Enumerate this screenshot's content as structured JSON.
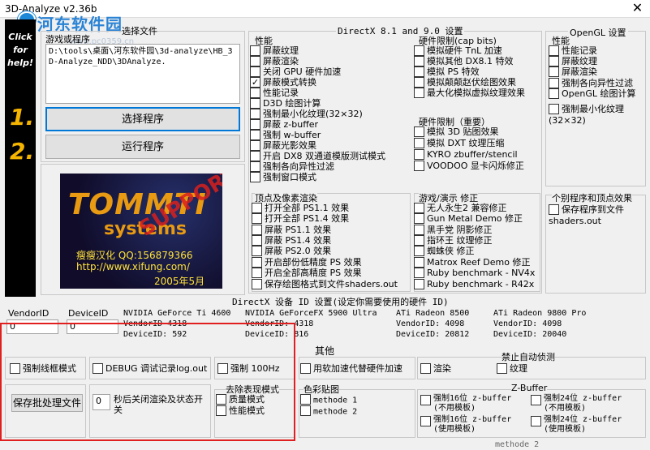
{
  "window": {
    "title": "3D-Analyze v2.36b",
    "close_glyph": "✕"
  },
  "watermark": {
    "name": "河东软件园",
    "url": "www.pc0359.cn"
  },
  "strip": {
    "click_text": "Click\nfor\nhelp!",
    "step1": "1.",
    "step2": "2."
  },
  "program": {
    "section_label": "游戏或程序",
    "select_file_label": "选择文件",
    "path_text": "D:\\tools\\桌面\\河东软件园\\3d-analyze\\HB_3D-Analyze_NDD\\3DAnalyze.",
    "select_button": "选择程序",
    "run_button": "运行程序"
  },
  "logo": {
    "brand_line1": "TOMMTI",
    "brand_line2": "systems",
    "overlay": "SUPPORT",
    "credit": "瘦瘦汉化 QQ:156879366",
    "url": "http://www.xifung.com/",
    "date": "2005年5月"
  },
  "directx": {
    "header": "DirectX 8.1 and 9.0 设置",
    "performance": {
      "title": "性能",
      "items": [
        "屏蔽纹理",
        "屏蔽渲染",
        "关闭 GPU 硬件加速",
        "屏蔽模式转换",
        "性能记录",
        "D3D 绘图计算",
        "强制最小化纹理(32×32)",
        "屏蔽 z-buffer",
        "强制 w-buffer",
        "屏蔽光影效果",
        "开启 DX8 双通道模版测试模式",
        "强制各向异性过滤",
        "强制窗口模式"
      ],
      "checked": [
        false,
        false,
        false,
        true,
        false,
        false,
        false,
        false,
        false,
        false,
        false,
        false,
        false
      ]
    },
    "hwlimit_cap": {
      "title": "硬件限制(cap bits)",
      "items": [
        "模拟硬件 TnL 加速",
        "模拟其他 DX8.1 特效",
        "模拟 PS 特效",
        "模拟颠颠赵伏绘图效果",
        "最大化模拟虚拟纹理效果"
      ]
    },
    "hwlimit_important": {
      "title": "硬件限制（重要）",
      "items": [
        "模拟 3D 贴图效果",
        "模拟 DXT 纹理压缩",
        "KYRO zbuffer/stencil",
        "VOODOO 显卡闪烁修正"
      ]
    },
    "vertex_pixel": {
      "title": "顶点及像素渲染",
      "items": [
        "打开全部 PS1.1 效果",
        "打开全部 PS1.4 效果",
        "屏蔽 PS1.1 效果",
        "屏蔽 PS1.4 效果",
        "屏蔽 PS2.0 效果",
        "开启部份低精度 PS 效果",
        "开启全部高精度 PS 效果",
        "保存绘图格式到文件shaders.out"
      ]
    },
    "game_fix": {
      "title": "游戏/演示 修正",
      "items": [
        "无人永生2 兼容修正",
        "Gun Metal Demo 修正",
        "黑手党 阴影修正",
        "指环王 纹理修正",
        "蜘蛛侠 修正",
        "Matrox Reef Demo 修正",
        "Ruby benchmark - NV4x",
        "Ruby benchmark - R42x"
      ]
    }
  },
  "opengl": {
    "header": "OpenGL 设置",
    "performance_title": "性能",
    "items": [
      "性能记录",
      "屏蔽纹理",
      "屏蔽渲染",
      "强制各向异性过滤",
      "OpenGL 绘图计算",
      "强制最小化纹理(32×32)"
    ]
  },
  "individual": {
    "title": "个别程序和顶点效果",
    "items": [
      "保存程序到文件 shaders.out"
    ]
  },
  "device": {
    "header": "DirectX 设备 ID 设置(设定你需要使用的硬件 ID)",
    "vendor_label": "VendorID",
    "device_label": "DeviceID",
    "vendor_value": "0",
    "device_value": "0",
    "presets": [
      {
        "name": "NVIDIA GeForce Ti 4600",
        "vendor": "VendorID 4318",
        "device": "DeviceID: 592"
      },
      {
        "name": "NVIDIA GeForceFX 5900 Ultra",
        "vendor": "VendorID: 4318",
        "device": "DeviceID: 816"
      },
      {
        "name": "ATi Radeon 8500",
        "vendor": "VendorID: 4098",
        "device": "DeviceID: 20812"
      },
      {
        "name": "ATi Radeon 9800 Pro",
        "vendor": "VendorID: 4098",
        "device": "DeviceID: 20040"
      }
    ]
  },
  "other": {
    "header": "其他",
    "wireframe": "强制线框模式",
    "debug_log": "DEBUG 调试记录log.out",
    "force_hz": "强制 100Hz",
    "soft_accel": "用软加速代替硬件加速",
    "auto_detect_title": "禁止自动侦测",
    "auto_render": "渲染",
    "auto_texture": "纹理",
    "save_batch_button": "保存批处理文件",
    "seconds_value": "0",
    "seconds_label": "秒后关闭渲染及状态开关",
    "remove_title": "去除表现模式",
    "remove_items": [
      "质量模式",
      "性能模式"
    ],
    "color_title": "色彩贴图",
    "color_items": [
      "methode 1",
      "methode 2"
    ],
    "zbuffer_title": "Z-Buffer",
    "zbuffer_items": [
      "强制16位 z-buffer\n(不用模板)",
      "强制24位 z-buffer\n(不用模板)",
      "强制16位 z-buffer\n(使用模板)",
      "强制24位 z-buffer\n(使用模板)"
    ],
    "bottom_cut": "methode 2"
  }
}
